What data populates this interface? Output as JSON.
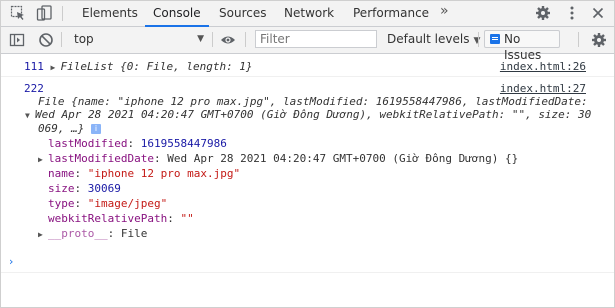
{
  "toolbar_tabs": {
    "elements": "Elements",
    "console": "Console",
    "sources": "Sources",
    "network": "Network",
    "performance": "Performance",
    "more": "»"
  },
  "console_toolbar": {
    "context": "top",
    "filter_placeholder": "Filter",
    "levels": "Default levels",
    "issues": "No Issues"
  },
  "entry1": {
    "count": "111",
    "summary": "FileList {0: File, length: 1}",
    "source": "index.html:26"
  },
  "entry2": {
    "count": "222",
    "source": "index.html:27",
    "preview_line1": "File {name: \"iphone 12 pro max.jpg\", lastModified: 1619558447986, lastModifiedDate:",
    "preview_line2": "Wed Apr 28 2021 04:20:47 GMT+0700 (Giờ Đông Dương), webkitRelativePath: \"\", size: 30",
    "preview_line3": "069, …}",
    "props": {
      "lastModified_key": "lastModified",
      "lastModified_val": "1619558447986",
      "lastModifiedDate_key": "lastModifiedDate",
      "lastModifiedDate_val": "Wed Apr 28 2021 04:20:47 GMT+0700 (Giờ Đông Dương) {}",
      "name_key": "name",
      "name_val": "\"iphone 12 pro max.jpg\"",
      "size_key": "size",
      "size_val": "30069",
      "type_key": "type",
      "type_val": "\"image/jpeg\"",
      "webkit_key": "webkitRelativePath",
      "webkit_val": "\"\"",
      "proto_key": "__proto__",
      "proto_val": "File"
    }
  },
  "prompt_symbol": "›",
  "colors": {
    "accent": "#1a73e8",
    "key": "#881280",
    "number": "#1a1aa6",
    "string": "#c41a16"
  }
}
